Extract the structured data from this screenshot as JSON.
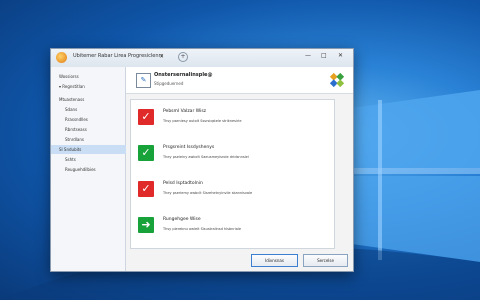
{
  "window": {
    "title": "Ubitemer Rabar Lirea Progresiclenrs",
    "tab_close": "×",
    "tab_add": "+",
    "minimize": "—",
    "maximize": "□",
    "close": "✕"
  },
  "sidebar": {
    "items": [
      {
        "label": "Wossiorss",
        "selected": false
      },
      {
        "label": "▾  Regnstitlan",
        "selected": false
      },
      {
        "label": "Mtuastenass",
        "selected": false
      },
      {
        "label": "Sdans",
        "selected": false
      },
      {
        "label": "Rrassndlles",
        "selected": false
      },
      {
        "label": "Rbrstseass",
        "selected": false
      },
      {
        "label": "Stnrdlans",
        "selected": false
      },
      {
        "label": "Sl  Sndubits",
        "selected": true
      },
      {
        "label": "Sshts",
        "selected": false
      },
      {
        "label": "Reuguehdilbies",
        "selected": false
      }
    ]
  },
  "header": {
    "icon": "✎",
    "title": "Onstersernalinsple@",
    "subtitle": "Stipgeduerned"
  },
  "items": [
    {
      "title": "Pebsml Valzar Wisz",
      "desc": "Thsy pseniesy autolt  Sssrsiqstele striknesirie",
      "icon": "✓",
      "color": "#e02a2a"
    },
    {
      "title": "Prsgsreint  Issdyshenys",
      "desc": "They pseieiny awbclt  Saeusmeyisrole dridsnnslel",
      "icon": "✓",
      "color": "#18a23a"
    },
    {
      "title": "Pelsd Isptadtolnin",
      "desc": "They pseriemy awbclt  Sisrehetnyinvile skannisvale",
      "icon": "✓",
      "color": "#e02a2a"
    },
    {
      "title": "Rungehgee Wise",
      "desc": "Thsy pierebnu owlelt  Sisustralinsd hlsbnriale",
      "icon": "➜",
      "color": "#18a23a"
    }
  ],
  "buttons": {
    "primary": "Idivnsnas",
    "secondary": "Sercelse"
  },
  "colors": {
    "accent": "#3c7fd0",
    "sidebar_selected": "#c9def5",
    "danger": "#e02a2a",
    "success": "#18a23a"
  }
}
